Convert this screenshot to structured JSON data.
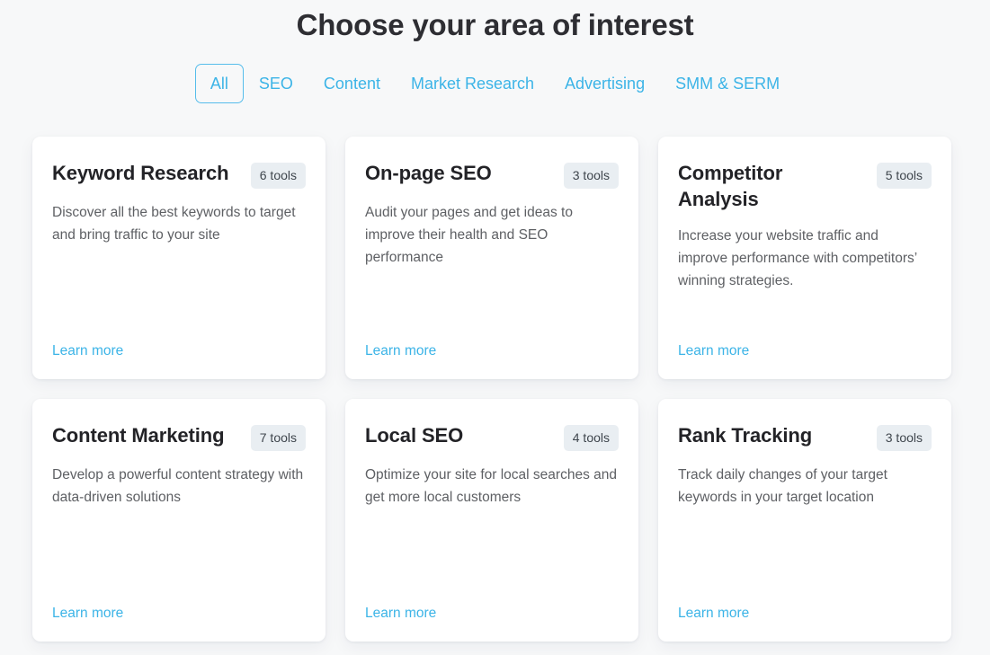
{
  "header": {
    "title": "Choose your area of interest"
  },
  "tabs": {
    "active_index": 0,
    "items": [
      {
        "label": "All"
      },
      {
        "label": "SEO"
      },
      {
        "label": "Content"
      },
      {
        "label": "Market Research"
      },
      {
        "label": "Advertising"
      },
      {
        "label": "SMM & SERM"
      }
    ]
  },
  "cards": [
    {
      "title": "Keyword Research",
      "badge": "6 tools",
      "description": "Discover all the best keywords to target and bring traffic to your site",
      "link": "Learn more"
    },
    {
      "title": "On-page SEO",
      "badge": "3 tools",
      "description": "Audit your pages and get ideas to improve their health and SEO performance",
      "link": "Learn more"
    },
    {
      "title": "Competitor Analysis",
      "badge": "5 tools",
      "description": "Increase your website traffic and improve performance with competitors’ winning strategies.",
      "link": "Learn more"
    },
    {
      "title": "Content Marketing",
      "badge": "7 tools",
      "description": "Develop a powerful content strategy with data-driven solutions",
      "link": "Learn more"
    },
    {
      "title": "Local SEO",
      "badge": "4 tools",
      "description": "Optimize your site for local searches and get more local customers",
      "link": "Learn more"
    },
    {
      "title": "Rank Tracking",
      "badge": "3 tools",
      "description": "Track daily changes of your target keywords in your target location",
      "link": "Learn more"
    }
  ],
  "colors": {
    "accent": "#3cb4e7",
    "page_background": "#f7f8f9",
    "card_background": "#ffffff",
    "badge_background": "#e9eef2",
    "title_text": "#2e2e33",
    "body_text": "#5e6064"
  }
}
